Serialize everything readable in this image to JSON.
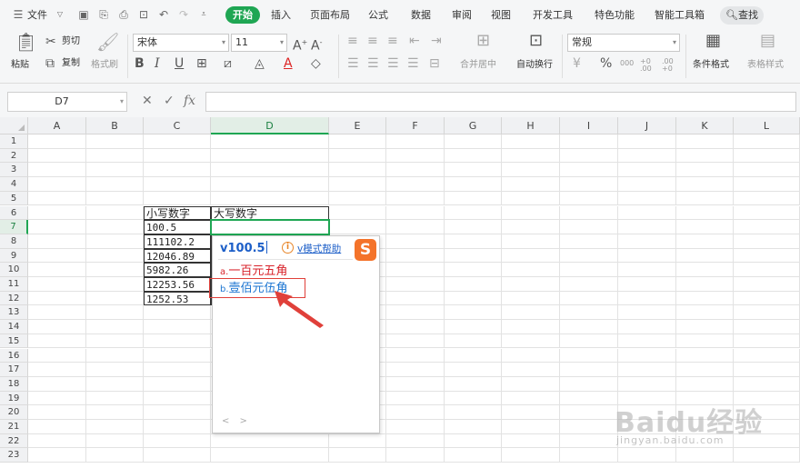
{
  "menubar": {
    "file": "文件",
    "tabs": [
      "开始",
      "插入",
      "页面布局",
      "公式",
      "数据",
      "审阅",
      "视图",
      "开发工具",
      "特色功能",
      "智能工具箱"
    ],
    "search": "查找"
  },
  "ribbon": {
    "paste": "粘贴",
    "cut": "剪切",
    "copy": "复制",
    "format_painter": "格式刷",
    "font_name": "宋体",
    "font_size": "11",
    "bold": "B",
    "italic": "I",
    "underline": "U",
    "merge_center": "合并居中",
    "wrap_text": "自动换行",
    "number_format": "常规",
    "currency": "¥",
    "percent": "%",
    "thousands": "000",
    "increase_decimal": "+0 .00",
    "decrease_decimal": ".00 +0",
    "conditional_format": "条件格式",
    "table_style": "表格样式"
  },
  "formula_bar": {
    "cell_ref": "D7",
    "cancel": "✕",
    "confirm": "✓",
    "fx": "fx",
    "value": ""
  },
  "grid": {
    "columns": [
      "A",
      "B",
      "C",
      "D",
      "E",
      "F",
      "G",
      "H",
      "I",
      "J",
      "K",
      "L"
    ],
    "rows": [
      "1",
      "2",
      "3",
      "4",
      "5",
      "6",
      "7",
      "8",
      "9",
      "10",
      "11",
      "12",
      "13",
      "14",
      "15",
      "16",
      "17",
      "18",
      "19",
      "20",
      "21",
      "22",
      "23"
    ],
    "selected_column": "D",
    "selected_row": "7",
    "header_small": "小写数字",
    "header_big": "大写数字",
    "values": [
      "100.5",
      "111102.2",
      "12046.89",
      "5982.26",
      "12253.56",
      "1252.53"
    ]
  },
  "ime": {
    "input": "v100.5",
    "help_icon": "i",
    "help": "v模式帮助",
    "logo": "S",
    "candidate_a_key": "a.",
    "candidate_a": "一百元五角",
    "candidate_b_key": "b.",
    "candidate_b": "壹佰元伍角",
    "nav": "< >"
  },
  "watermark": {
    "logo": "Baidu经验",
    "sub": "jingyan.baidu.com"
  },
  "colors": {
    "accent": "#1fa653",
    "ime_blue": "#1d5fc8",
    "candidate_a": "#d8222a",
    "candidate_b": "#1d76d2",
    "annotation_red": "#e0403a"
  }
}
